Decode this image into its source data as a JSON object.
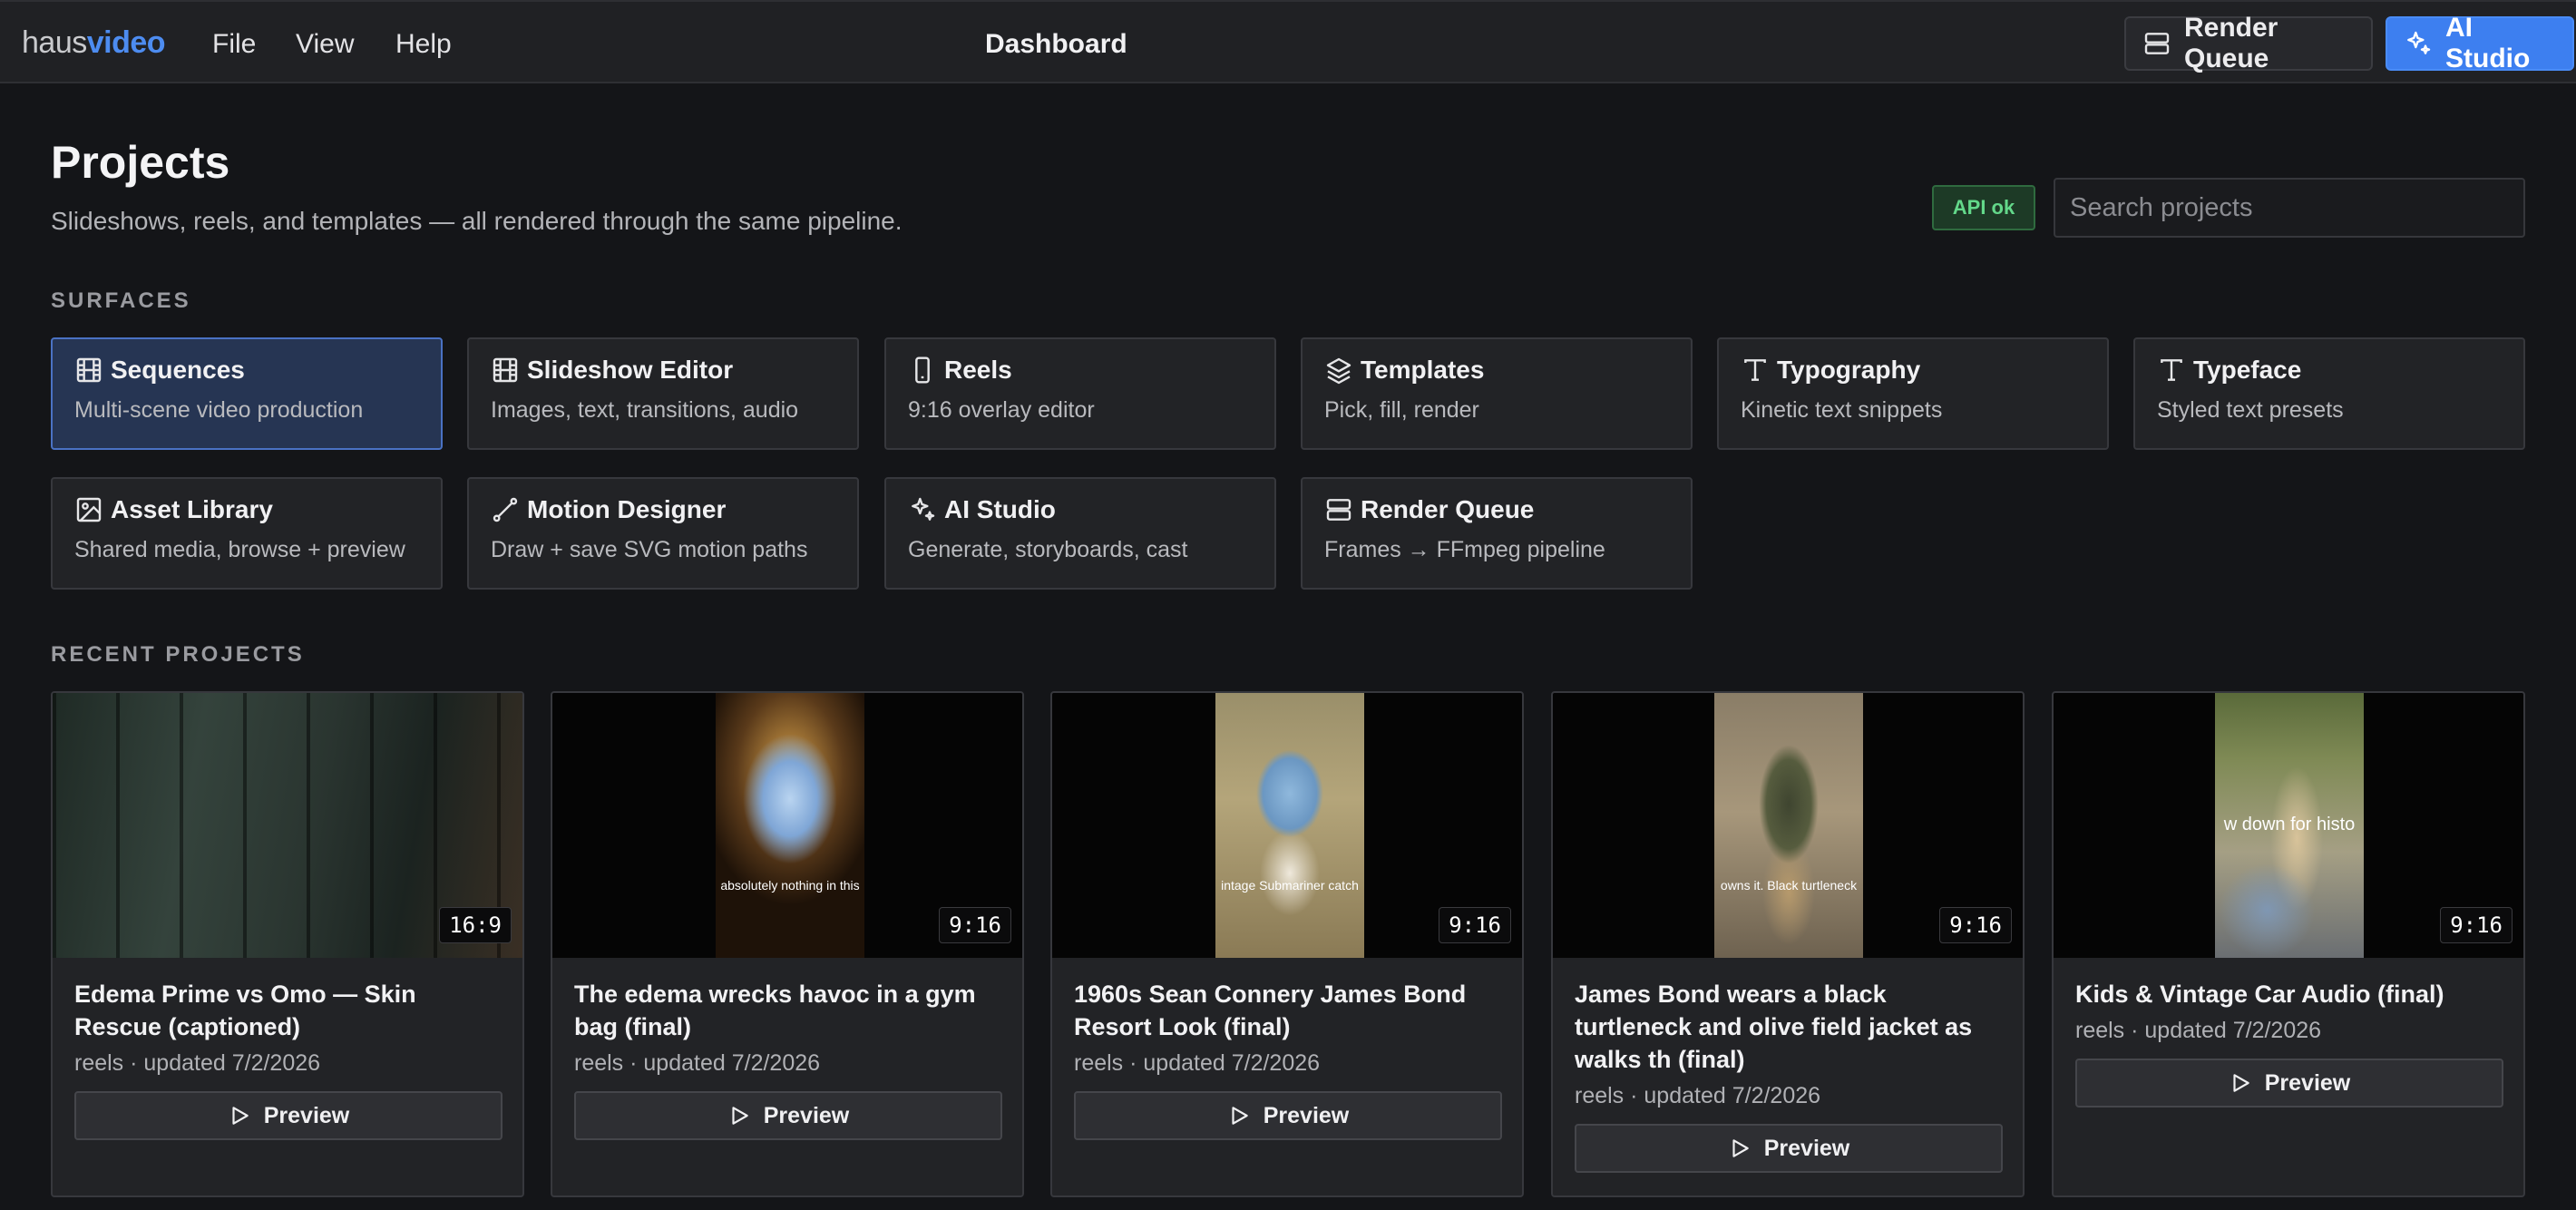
{
  "app": {
    "logo_part1": "haus",
    "logo_part2": "video",
    "menu": [
      "File",
      "View",
      "Help"
    ],
    "title": "Dashboard",
    "render_queue_label": "Render Queue",
    "ai_studio_label": "AI Studio"
  },
  "header": {
    "title": "Projects",
    "subtitle": "Slideshows, reels, and templates — all rendered through the same pipeline.",
    "api_status": "API ok",
    "search_placeholder": "Search projects"
  },
  "surfaces": {
    "label": "SURFACES",
    "items": [
      {
        "title": "Sequences",
        "desc": "Multi-scene video production",
        "icon": "film-icon",
        "active": true
      },
      {
        "title": "Slideshow Editor",
        "desc": "Images, text, transitions, audio",
        "icon": "film-icon"
      },
      {
        "title": "Reels",
        "desc": "9:16 overlay editor",
        "icon": "phone-icon"
      },
      {
        "title": "Templates",
        "desc": "Pick, fill, render",
        "icon": "layers-icon"
      },
      {
        "title": "Typography",
        "desc": "Kinetic text snippets",
        "icon": "type-icon"
      },
      {
        "title": "Typeface",
        "desc": "Styled text presets",
        "icon": "type-icon"
      },
      {
        "title": "Asset Library",
        "desc": "Shared media, browse + preview",
        "icon": "image-icon"
      },
      {
        "title": "Motion Designer",
        "desc": "Draw + save SVG motion paths",
        "icon": "path-icon"
      },
      {
        "title": "AI Studio",
        "desc": "Generate, storyboards, cast",
        "icon": "sparkles-icon"
      },
      {
        "title": "Render Queue",
        "desc": "Frames → FFmpeg pipeline",
        "icon": "server-icon"
      }
    ]
  },
  "recent": {
    "label": "RECENT PROJECTS",
    "preview_label": "Preview",
    "projects": [
      {
        "title": "Edema Prime vs Omo — Skin Rescue (captioned)",
        "meta": "reels · updated 7/2/2026",
        "ratio": "16:9",
        "caption": ""
      },
      {
        "title": "The edema wrecks havoc in a gym bag (final)",
        "meta": "reels · updated 7/2/2026",
        "ratio": "9:16",
        "caption": "absolutely nothing in this"
      },
      {
        "title": "1960s Sean Connery James Bond Resort Look (final)",
        "meta": "reels · updated 7/2/2026",
        "ratio": "9:16",
        "caption": "intage Submariner catch"
      },
      {
        "title": "James Bond wears a black turtleneck and olive field jacket as walks th (final)",
        "meta": "reels · updated 7/2/2026",
        "ratio": "9:16",
        "caption": "owns it. Black turtleneck"
      },
      {
        "title": "Kids & Vintage Car Audio (final)",
        "meta": "reels · updated 7/2/2026",
        "ratio": "9:16",
        "caption": "w down for histo"
      }
    ]
  }
}
